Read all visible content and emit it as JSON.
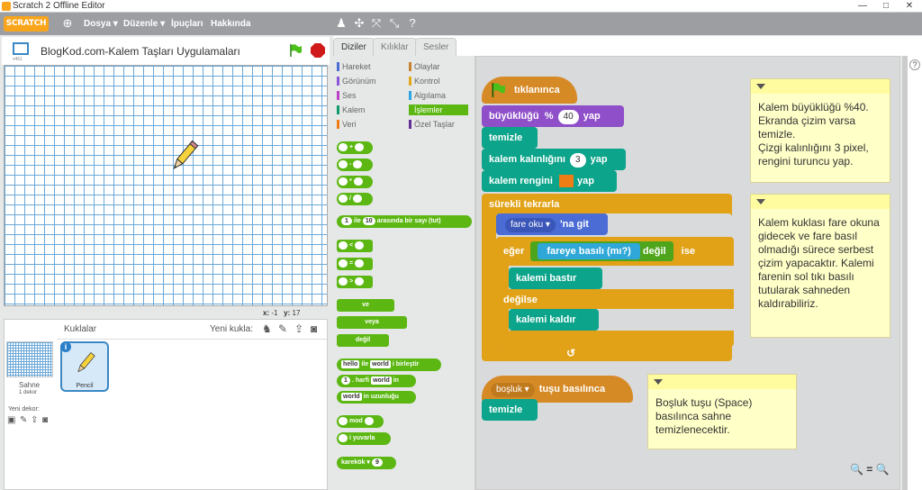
{
  "window": {
    "title": "Scratch 2 Offline Editor",
    "controls": [
      "—",
      "□",
      "✕"
    ]
  },
  "menu": {
    "logo": "SCRATCH",
    "items": [
      "Dosya ▾",
      "Düzenle ▾",
      "İpuçları",
      "Hakkında"
    ]
  },
  "stage": {
    "title": "BlogKod.com-Kalem Taşları Uygulamaları",
    "version": "v461",
    "x_label": "x:",
    "x_value": "-1",
    "y_label": "y:",
    "y_value": "17"
  },
  "sprites": {
    "header": "Kuklalar",
    "new_sprite": "Yeni kukla:",
    "stage_label": "Sahne",
    "stage_backdrops": "1 dekor",
    "new_backdrop": "Yeni dekor:",
    "sprite_name": "Pencil"
  },
  "tabs": [
    "Diziler",
    "Kılıklar",
    "Sesler"
  ],
  "categories": [
    {
      "label": "Hareket",
      "color": "#4a6cd4"
    },
    {
      "label": "Olaylar",
      "color": "#c88330"
    },
    {
      "label": "Görünüm",
      "color": "#8a55d7"
    },
    {
      "label": "Kontrol",
      "color": "#e1a91a"
    },
    {
      "label": "Ses",
      "color": "#bb42c3"
    },
    {
      "label": "Algılama",
      "color": "#2ca5e2"
    },
    {
      "label": "Kalem",
      "color": "#0e9a6c"
    },
    {
      "label": "İşlemler",
      "color": "#5cb712"
    },
    {
      "label": "Veri",
      "color": "#ee7d16"
    },
    {
      "label": "Özel Taşlar",
      "color": "#632d99"
    }
  ],
  "palette": {
    "ops": [
      "+",
      "-",
      "*",
      "/"
    ],
    "random": [
      "1",
      "ile",
      "10",
      "arasında bir sayı (tut)"
    ],
    "compare": [
      "<",
      "=",
      ">"
    ],
    "bools": [
      "ve",
      "veya",
      "değil"
    ],
    "join": [
      "hello",
      "ile",
      "world",
      "i birleştir"
    ],
    "letter": [
      "1",
      ". harfi",
      "world",
      "in"
    ],
    "length": [
      "world",
      "in uzunluğu"
    ],
    "mod": "mod",
    "round": "i yuvarla",
    "sqrt": [
      "karekök ▾",
      "9"
    ]
  },
  "script": {
    "hat": "tıklanınca",
    "size": [
      "büyüklüğü",
      "%",
      "40",
      "yap"
    ],
    "clear": "temizle",
    "penSize": [
      "kalem kalınlığını",
      "3",
      "yap"
    ],
    "penColor": [
      "kalem rengini",
      "yap"
    ],
    "forever": "sürekli tekrarla",
    "goto": [
      "fare oku ▾",
      "'na git"
    ],
    "if": "eğer",
    "not": "değil",
    "mouse": [
      "fareye basılı (mı?)"
    ],
    "ise": "ise",
    "penDown": "kalemi bastır",
    "else": "değilse",
    "penUp": "kalemi kaldır",
    "keyHat": [
      "boşluk ▾",
      "tuşu basılınca"
    ],
    "clear2": "temizle",
    "pen_color_swatch": "#ee7d16"
  },
  "notes": [
    "Kalem büyüklüğü %40. Ekranda çizim varsa temizle.\nÇizgi kalınlığını 3 pixel, rengini turuncu yap.",
    "Kalem kuklası fare okuna gidecek ve fare basıl olmadığı sürece serbest çizim yapacaktır. Kalemi farenin sol tıkı basılı tutularak sahneden kaldırabiliriz.",
    "Boşluk tuşu (Space) basılınca sahne temizlenecektir."
  ],
  "zoom": "🔍 = 🔍"
}
